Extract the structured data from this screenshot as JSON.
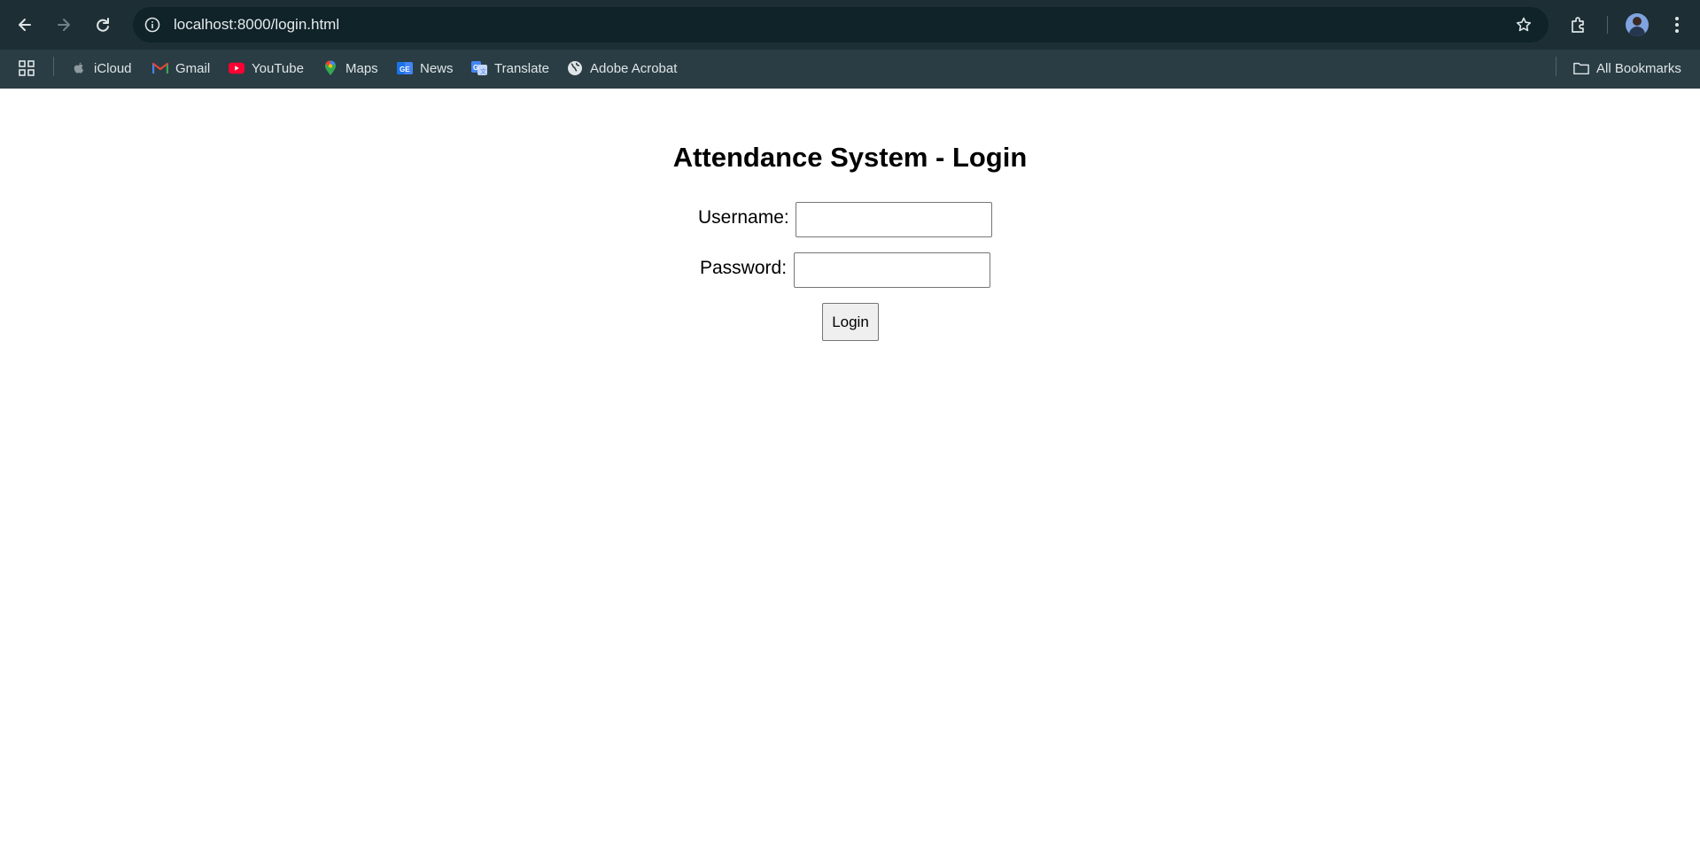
{
  "browser": {
    "address": {
      "url": "localhost:8000/login.html",
      "info_icon": "info-icon",
      "star_icon": "star-icon"
    },
    "nav_icons": [
      "back-arrow-icon",
      "forward-arrow-icon",
      "reload-icon"
    ],
    "bookmarks": {
      "apps_icon": "apps-grid-icon",
      "items": [
        {
          "label": "iCloud",
          "icon": "apple-icon"
        },
        {
          "label": "Gmail",
          "icon": "gmail-icon"
        },
        {
          "label": "YouTube",
          "icon": "youtube-icon"
        },
        {
          "label": "Maps",
          "icon": "maps-pin-icon"
        },
        {
          "label": "News",
          "icon": "news-icon"
        },
        {
          "label": "Translate",
          "icon": "translate-icon"
        },
        {
          "label": "Adobe Acrobat",
          "icon": "globe-icon"
        }
      ],
      "all_bookmarks": "All Bookmarks"
    },
    "colors": {
      "toolbar": "#1d2f34",
      "bookmarks_bar": "#2a3d44",
      "omnibox": "#0f2328"
    }
  },
  "page": {
    "title": "Attendance System - Login",
    "form": {
      "username_label": "Username:",
      "username_value": "",
      "password_label": "Password:",
      "password_value": "",
      "login_label": "Login"
    }
  }
}
